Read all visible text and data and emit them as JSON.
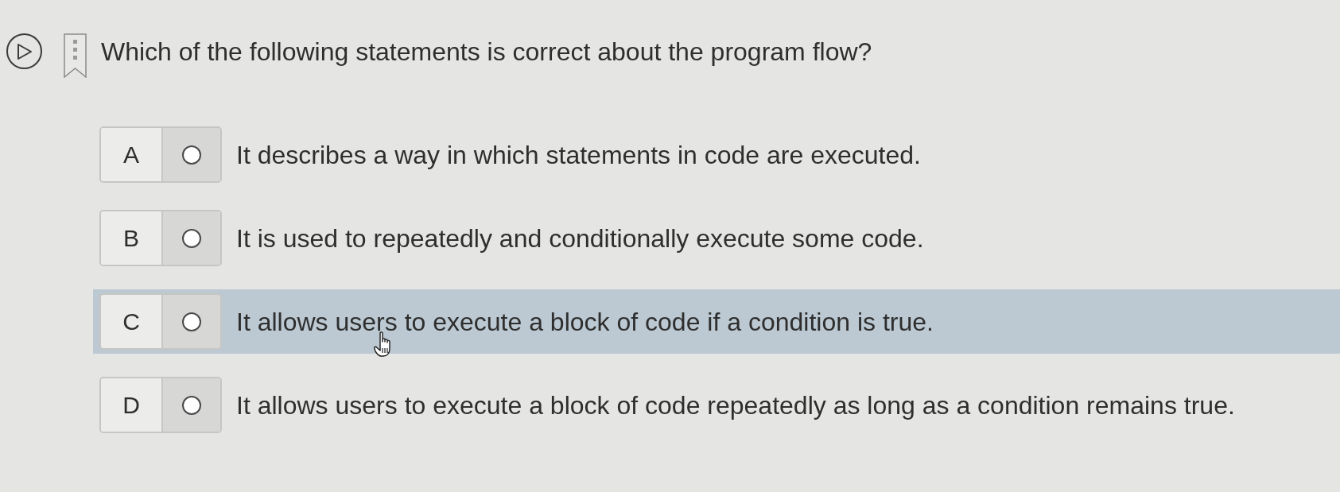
{
  "question": {
    "text": "Which of the following statements is correct about the program flow?"
  },
  "options": [
    {
      "letter": "A",
      "text": "It describes a way in which statements in code are executed.",
      "checked": false,
      "highlighted": false
    },
    {
      "letter": "B",
      "text": "It is used to repeatedly and conditionally execute some code.",
      "checked": false,
      "highlighted": false
    },
    {
      "letter": "C",
      "text": "It allows users to execute a block of code if a condition is true.",
      "checked": false,
      "highlighted": true
    },
    {
      "letter": "D",
      "text": "It allows users to execute a block of code repeatedly as long as a condition remains true.",
      "checked": false,
      "highlighted": false
    }
  ]
}
